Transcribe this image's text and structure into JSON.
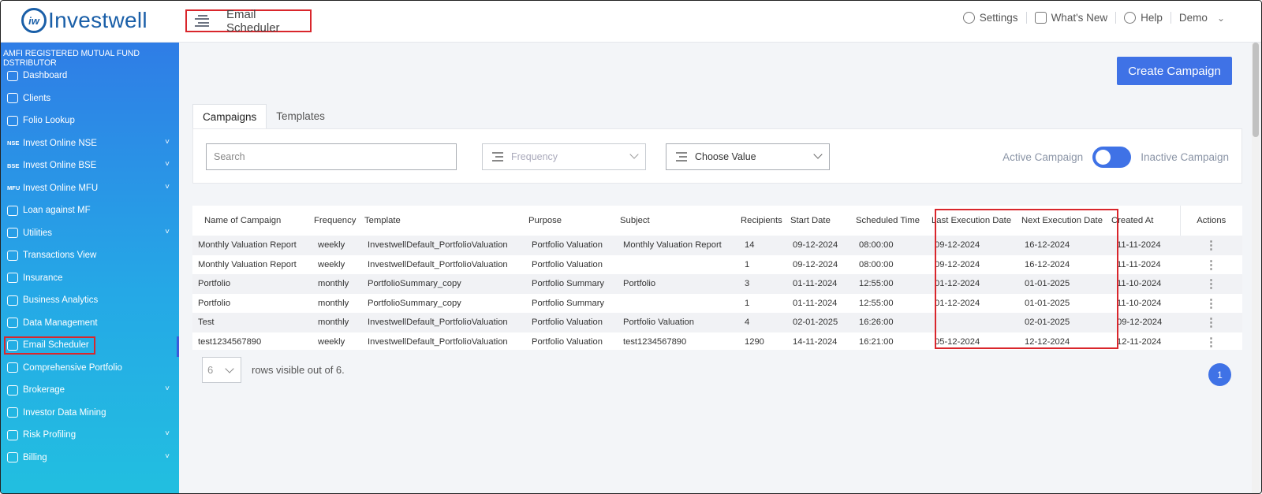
{
  "brand": {
    "logo_mark": "iw",
    "name": "Investwell"
  },
  "header": {
    "page_title": "Email Scheduler",
    "settings": "Settings",
    "whats_new": "What's New",
    "help": "Help",
    "user": "Demo"
  },
  "sidebar": {
    "org": "AMFI REGISTERED MUTUAL FUND DSTRIBUTOR",
    "items": [
      {
        "label": "Dashboard",
        "icon": "home-icon"
      },
      {
        "label": "Clients",
        "icon": "users-icon"
      },
      {
        "label": "Folio Lookup",
        "icon": "folio-icon"
      },
      {
        "label": "Invest Online NSE",
        "tag": "NSE",
        "chevron": true
      },
      {
        "label": "Invest Online BSE",
        "tag": "BSE",
        "chevron": true
      },
      {
        "label": "Invest Online MFU",
        "tag": "MFU",
        "chevron": true
      },
      {
        "label": "Loan against MF",
        "icon": "loan-icon"
      },
      {
        "label": "Utilities",
        "icon": "utilities-icon",
        "chevron": true
      },
      {
        "label": "Transactions View",
        "icon": "transfer-icon"
      },
      {
        "label": "Insurance",
        "icon": "insurance-icon"
      },
      {
        "label": "Business Analytics",
        "icon": "analytics-icon"
      },
      {
        "label": "Data Management",
        "icon": "data-icon"
      },
      {
        "label": "Email Scheduler",
        "icon": "email-icon",
        "active": true
      },
      {
        "label": "Comprehensive Portfolio",
        "icon": "briefcase-icon"
      },
      {
        "label": "Brokerage",
        "icon": "percent-icon",
        "chevron": true
      },
      {
        "label": "Investor Data Mining",
        "icon": "rupee-icon"
      },
      {
        "label": "Risk Profiling",
        "icon": "gauge-icon",
        "chevron": true
      },
      {
        "label": "Billing",
        "icon": "billing-icon",
        "chevron": true
      }
    ]
  },
  "actions": {
    "create_campaign": "Create Campaign"
  },
  "tabs": [
    "Campaigns",
    "Templates"
  ],
  "filters": {
    "search_placeholder": "Search",
    "frequency_placeholder": "Frequency",
    "choose_value": "Choose Value",
    "active_label": "Active Campaign",
    "inactive_label": "Inactive Campaign"
  },
  "table": {
    "headers": [
      "Name of Campaign",
      "Frequency",
      "Template",
      "Purpose",
      "Subject",
      "Recipients",
      "Start Date",
      "Scheduled Time",
      "Last Execution Date",
      "Next Execution Date",
      "Created At",
      "Actions"
    ],
    "rows": [
      [
        "Monthly Valuation Report",
        "weekly",
        "InvestwellDefault_PortfolioValuation",
        "Portfolio Valuation",
        "Monthly Valuation Report",
        "14",
        "09-12-2024",
        "08:00:00",
        "09-12-2024",
        "16-12-2024",
        "11-11-2024",
        "⋮"
      ],
      [
        "Monthly Valuation Report",
        "weekly",
        "InvestwellDefault_PortfolioValuation",
        "Portfolio Valuation",
        "",
        "1",
        "09-12-2024",
        "08:00:00",
        "09-12-2024",
        "16-12-2024",
        "11-11-2024",
        "⋮"
      ],
      [
        "Portfolio",
        "monthly",
        "PortfolioSummary_copy",
        "Portfolio Summary",
        "Portfolio",
        "3",
        "01-11-2024",
        "12:55:00",
        "01-12-2024",
        "01-01-2025",
        "11-10-2024",
        "⋮"
      ],
      [
        "Portfolio",
        "monthly",
        "PortfolioSummary_copy",
        "Portfolio Summary",
        "",
        "1",
        "01-11-2024",
        "12:55:00",
        "01-12-2024",
        "01-01-2025",
        "11-10-2024",
        "⋮"
      ],
      [
        "Test",
        "monthly",
        "InvestwellDefault_PortfolioValuation",
        "Portfolio Valuation",
        "Portfolio Valuation",
        "4",
        "02-01-2025",
        "16:26:00",
        "",
        "02-01-2025",
        "09-12-2024",
        "⋮"
      ],
      [
        "test1234567890",
        "weekly",
        "InvestwellDefault_PortfolioValuation",
        "Portfolio Valuation",
        "test1234567890",
        "1290",
        "14-11-2024",
        "16:21:00",
        "05-12-2024",
        "12-12-2024",
        "12-11-2024",
        "⋮"
      ]
    ]
  },
  "pagination": {
    "rows_value": "6",
    "rows_text": "rows visible out of 6.",
    "current_page": "1"
  },
  "colors": {
    "accent": "#3f72e6",
    "highlight": "#d9262c",
    "sidebar_top": "#2f7de6",
    "sidebar_bottom": "#22bfe0"
  }
}
